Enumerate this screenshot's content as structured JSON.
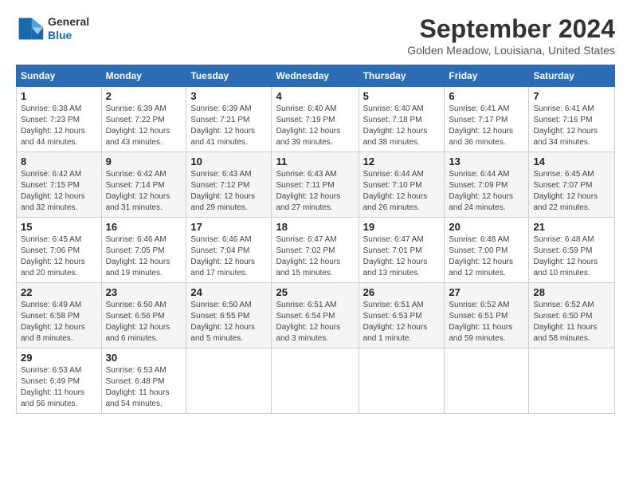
{
  "logo": {
    "line1": "General",
    "line2": "Blue"
  },
  "title": "September 2024",
  "location": "Golden Meadow, Louisiana, United States",
  "days_header": [
    "Sunday",
    "Monday",
    "Tuesday",
    "Wednesday",
    "Thursday",
    "Friday",
    "Saturday"
  ],
  "weeks": [
    [
      {
        "day": "1",
        "info": "Sunrise: 6:38 AM\nSunset: 7:23 PM\nDaylight: 12 hours\nand 44 minutes."
      },
      {
        "day": "2",
        "info": "Sunrise: 6:39 AM\nSunset: 7:22 PM\nDaylight: 12 hours\nand 43 minutes."
      },
      {
        "day": "3",
        "info": "Sunrise: 6:39 AM\nSunset: 7:21 PM\nDaylight: 12 hours\nand 41 minutes."
      },
      {
        "day": "4",
        "info": "Sunrise: 6:40 AM\nSunset: 7:19 PM\nDaylight: 12 hours\nand 39 minutes."
      },
      {
        "day": "5",
        "info": "Sunrise: 6:40 AM\nSunset: 7:18 PM\nDaylight: 12 hours\nand 38 minutes."
      },
      {
        "day": "6",
        "info": "Sunrise: 6:41 AM\nSunset: 7:17 PM\nDaylight: 12 hours\nand 36 minutes."
      },
      {
        "day": "7",
        "info": "Sunrise: 6:41 AM\nSunset: 7:16 PM\nDaylight: 12 hours\nand 34 minutes."
      }
    ],
    [
      {
        "day": "8",
        "info": "Sunrise: 6:42 AM\nSunset: 7:15 PM\nDaylight: 12 hours\nand 32 minutes."
      },
      {
        "day": "9",
        "info": "Sunrise: 6:42 AM\nSunset: 7:14 PM\nDaylight: 12 hours\nand 31 minutes."
      },
      {
        "day": "10",
        "info": "Sunrise: 6:43 AM\nSunset: 7:12 PM\nDaylight: 12 hours\nand 29 minutes."
      },
      {
        "day": "11",
        "info": "Sunrise: 6:43 AM\nSunset: 7:11 PM\nDaylight: 12 hours\nand 27 minutes."
      },
      {
        "day": "12",
        "info": "Sunrise: 6:44 AM\nSunset: 7:10 PM\nDaylight: 12 hours\nand 26 minutes."
      },
      {
        "day": "13",
        "info": "Sunrise: 6:44 AM\nSunset: 7:09 PM\nDaylight: 12 hours\nand 24 minutes."
      },
      {
        "day": "14",
        "info": "Sunrise: 6:45 AM\nSunset: 7:07 PM\nDaylight: 12 hours\nand 22 minutes."
      }
    ],
    [
      {
        "day": "15",
        "info": "Sunrise: 6:45 AM\nSunset: 7:06 PM\nDaylight: 12 hours\nand 20 minutes."
      },
      {
        "day": "16",
        "info": "Sunrise: 6:46 AM\nSunset: 7:05 PM\nDaylight: 12 hours\nand 19 minutes."
      },
      {
        "day": "17",
        "info": "Sunrise: 6:46 AM\nSunset: 7:04 PM\nDaylight: 12 hours\nand 17 minutes."
      },
      {
        "day": "18",
        "info": "Sunrise: 6:47 AM\nSunset: 7:02 PM\nDaylight: 12 hours\nand 15 minutes."
      },
      {
        "day": "19",
        "info": "Sunrise: 6:47 AM\nSunset: 7:01 PM\nDaylight: 12 hours\nand 13 minutes."
      },
      {
        "day": "20",
        "info": "Sunrise: 6:48 AM\nSunset: 7:00 PM\nDaylight: 12 hours\nand 12 minutes."
      },
      {
        "day": "21",
        "info": "Sunrise: 6:48 AM\nSunset: 6:59 PM\nDaylight: 12 hours\nand 10 minutes."
      }
    ],
    [
      {
        "day": "22",
        "info": "Sunrise: 6:49 AM\nSunset: 6:58 PM\nDaylight: 12 hours\nand 8 minutes."
      },
      {
        "day": "23",
        "info": "Sunrise: 6:50 AM\nSunset: 6:56 PM\nDaylight: 12 hours\nand 6 minutes."
      },
      {
        "day": "24",
        "info": "Sunrise: 6:50 AM\nSunset: 6:55 PM\nDaylight: 12 hours\nand 5 minutes."
      },
      {
        "day": "25",
        "info": "Sunrise: 6:51 AM\nSunset: 6:54 PM\nDaylight: 12 hours\nand 3 minutes."
      },
      {
        "day": "26",
        "info": "Sunrise: 6:51 AM\nSunset: 6:53 PM\nDaylight: 12 hours\nand 1 minute."
      },
      {
        "day": "27",
        "info": "Sunrise: 6:52 AM\nSunset: 6:51 PM\nDaylight: 11 hours\nand 59 minutes."
      },
      {
        "day": "28",
        "info": "Sunrise: 6:52 AM\nSunset: 6:50 PM\nDaylight: 11 hours\nand 58 minutes."
      }
    ],
    [
      {
        "day": "29",
        "info": "Sunrise: 6:53 AM\nSunset: 6:49 PM\nDaylight: 11 hours\nand 56 minutes."
      },
      {
        "day": "30",
        "info": "Sunrise: 6:53 AM\nSunset: 6:48 PM\nDaylight: 11 hours\nand 54 minutes."
      },
      {
        "day": "",
        "info": ""
      },
      {
        "day": "",
        "info": ""
      },
      {
        "day": "",
        "info": ""
      },
      {
        "day": "",
        "info": ""
      },
      {
        "day": "",
        "info": ""
      }
    ]
  ]
}
